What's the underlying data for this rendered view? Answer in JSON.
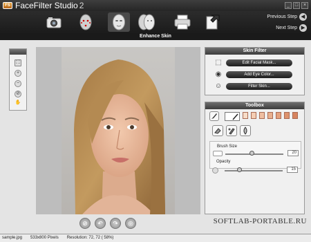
{
  "app": {
    "title": "FaceFilter Studio",
    "version": "2",
    "logo_text": "FS"
  },
  "window_controls": {
    "minimize": "_",
    "maximize": "□",
    "close": "×"
  },
  "toolbar": {
    "tools": [
      {
        "icon": "camera-icon"
      },
      {
        "icon": "face-markers-icon"
      },
      {
        "icon": "face-mask-icon"
      },
      {
        "icon": "faces-compare-icon"
      },
      {
        "icon": "printer-icon"
      },
      {
        "icon": "export-icon"
      }
    ],
    "previous_step": "Previous Step",
    "next_step": "Next Step"
  },
  "step_title": "Enhance Skin",
  "left_tools": {
    "icons": [
      "fit-icon",
      "zoom-in-icon",
      "zoom-out-icon",
      "no-icon",
      "hand-icon"
    ],
    "glyphs": [
      "⛶",
      "+",
      "−",
      "⊘",
      "✋"
    ]
  },
  "bottom_controls": [
    {
      "icon": "reset-icon",
      "glyph": "⊘"
    },
    {
      "icon": "undo-icon",
      "glyph": "↶"
    },
    {
      "icon": "redo-icon",
      "glyph": "↷"
    },
    {
      "icon": "target-icon",
      "glyph": "◎"
    }
  ],
  "skin_filter": {
    "header": "Skin Filter",
    "buttons": [
      "Edit Facial Mask...",
      "Add Eye Color...",
      "Filter Skin..."
    ]
  },
  "toolbox": {
    "header": "Toolbox",
    "swatches": [
      "#f7dcc7",
      "#f4cdb3",
      "#efbfa2",
      "#e9b08f",
      "#e4a17e",
      "#dd926d",
      "#d7845f"
    ],
    "brush_size_label": "Brush Size",
    "brush_size_value": "20",
    "brush_size_level": 0.45,
    "opacity_label": "Opacity",
    "opacity_value": "15",
    "opacity_level": 0.25
  },
  "status": {
    "file": "sample.jpg",
    "dimensions": "533x800 Pixels",
    "resolution": "Resolution: 72, 72 ( 58%)"
  },
  "watermark": "SOFTLAB-PORTABLE.RU",
  "colors": {
    "accent": "#2a2a2a",
    "panel": "#f0f0f0"
  }
}
